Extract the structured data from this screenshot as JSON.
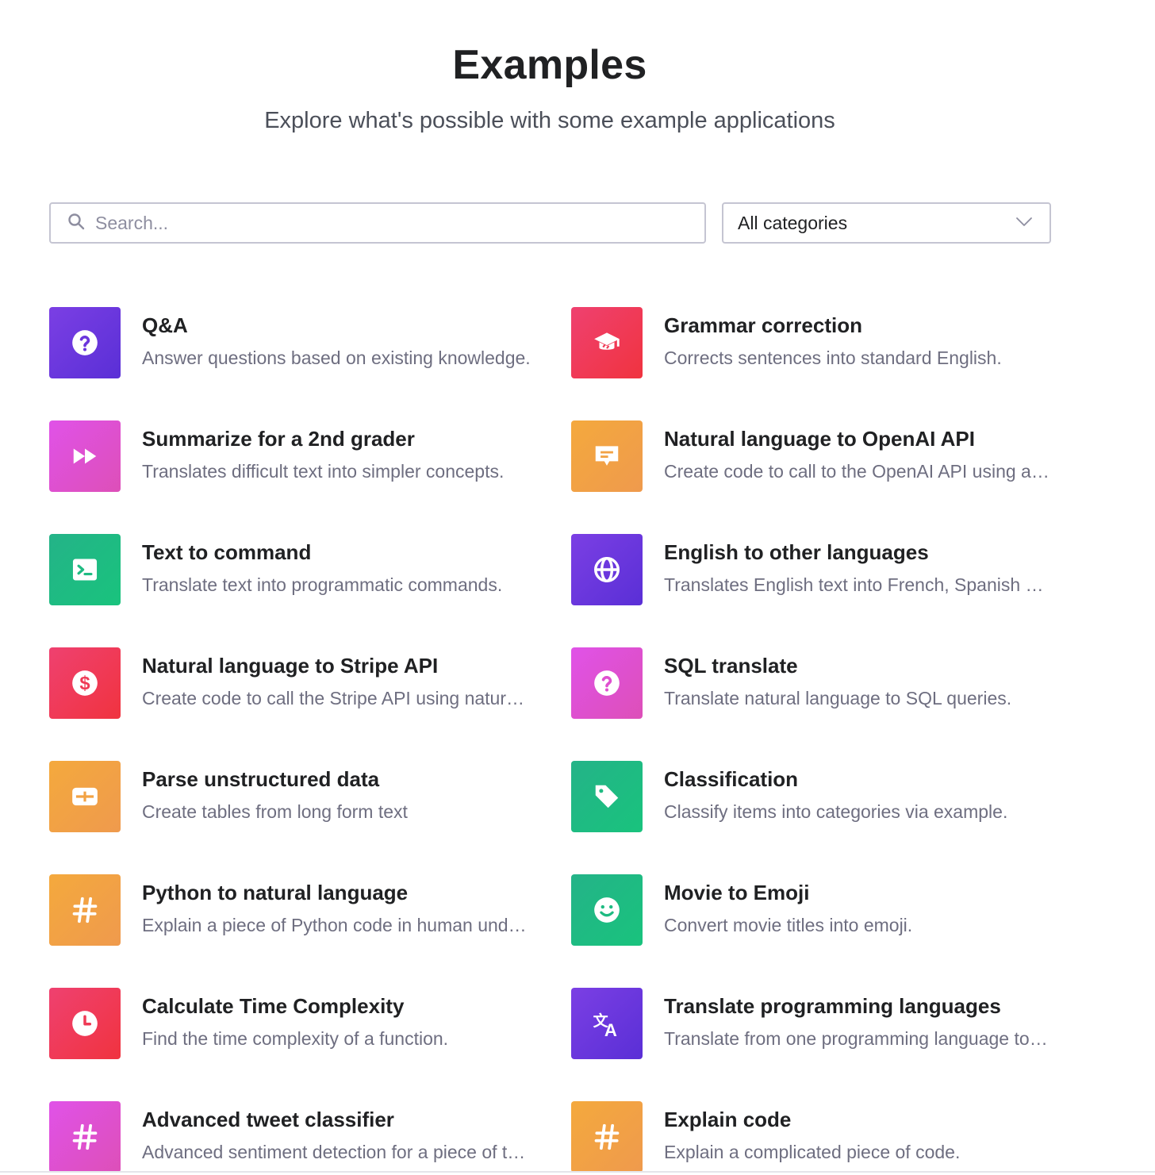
{
  "header": {
    "title": "Examples",
    "subtitle": "Explore what's possible with some example applications"
  },
  "search": {
    "placeholder": "Search...",
    "value": ""
  },
  "category_select": {
    "selected": "All categories"
  },
  "colors": {
    "purple": "#6b36dc",
    "red": "#ef3a55",
    "magenta": "#df50d0",
    "orange": "#f2a244",
    "green": "#1fbb82"
  },
  "examples": [
    {
      "title": "Q&A",
      "description": "Answer questions based on existing knowledge.",
      "icon": "question-circle-icon",
      "color": "purple"
    },
    {
      "title": "Grammar correction",
      "description": "Corrects sentences into standard English.",
      "icon": "graduation-cap-icon",
      "color": "red"
    },
    {
      "title": "Summarize for a 2nd grader",
      "description": "Translates difficult text into simpler concepts.",
      "icon": "fast-forward-icon",
      "color": "magenta"
    },
    {
      "title": "Natural language to OpenAI API",
      "description": "Create code to call to the OpenAI API using a natural language instruction.",
      "icon": "chat-bubble-icon",
      "color": "orange"
    },
    {
      "title": "Text to command",
      "description": "Translate text into programmatic commands.",
      "icon": "terminal-icon",
      "color": "green"
    },
    {
      "title": "English to other languages",
      "description": "Translates English text into French, Spanish and Japanese.",
      "icon": "globe-icon",
      "color": "purple"
    },
    {
      "title": "Natural language to Stripe API",
      "description": "Create code to call the Stripe API using natural language.",
      "icon": "dollar-circle-icon",
      "color": "red"
    },
    {
      "title": "SQL translate",
      "description": "Translate natural language to SQL queries.",
      "icon": "question-circle-icon",
      "color": "magenta"
    },
    {
      "title": "Parse unstructured data",
      "description": "Create tables from long form text",
      "icon": "table-icon",
      "color": "orange"
    },
    {
      "title": "Classification",
      "description": "Classify items into categories via example.",
      "icon": "tag-icon",
      "color": "green"
    },
    {
      "title": "Python to natural language",
      "description": "Explain a piece of Python code in human understandable language.",
      "icon": "hashtag-icon",
      "color": "orange"
    },
    {
      "title": "Movie to Emoji",
      "description": "Convert movie titles into emoji.",
      "icon": "smiley-icon",
      "color": "green"
    },
    {
      "title": "Calculate Time Complexity",
      "description": "Find the time complexity of a function.",
      "icon": "clock-icon",
      "color": "red"
    },
    {
      "title": "Translate programming languages",
      "description": "Translate from one programming language to another.",
      "icon": "translate-icon",
      "color": "purple"
    },
    {
      "title": "Advanced tweet classifier",
      "description": "Advanced sentiment detection for a piece of text.",
      "icon": "hashtag-icon",
      "color": "magenta"
    },
    {
      "title": "Explain code",
      "description": "Explain a complicated piece of code.",
      "icon": "hashtag-icon",
      "color": "orange"
    }
  ]
}
